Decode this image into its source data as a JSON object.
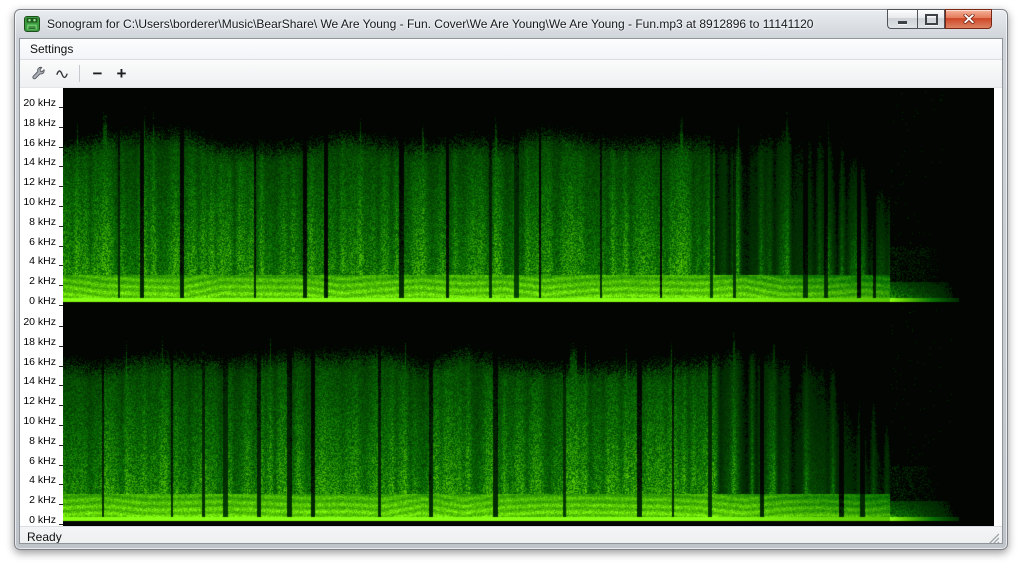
{
  "window": {
    "title": "Sonogram for C:\\Users\\borderer\\Music\\BearShare\\ We Are Young - Fun. Cover\\We Are Young\\We Are Young - Fun.mp3 at 8912896 to 11141120",
    "controls": {
      "minimize": "minimize",
      "maximize": "maximize",
      "close": "close"
    }
  },
  "menu": {
    "items": [
      {
        "label": "Settings"
      }
    ]
  },
  "toolbar": {
    "buttons": [
      {
        "name": "settings-wrench",
        "icon": "wrench-icon"
      },
      {
        "name": "waveform",
        "icon": "sine-wave-icon"
      },
      {
        "name": "zoom-out",
        "label": "−"
      },
      {
        "name": "zoom-in",
        "label": "+"
      }
    ],
    "zoom_out_label": "−",
    "zoom_in_label": "+"
  },
  "statusbar": {
    "text": "Ready"
  },
  "spectrogram": {
    "type": "spectrogram",
    "channels": [
      "left channel",
      "right channel"
    ],
    "freq_labels": [
      "20 kHz",
      "18 kHz",
      "16 kHz",
      "14 kHz",
      "12 kHz",
      "10 kHz",
      "8 kHz",
      "6 kHz",
      "4 kHz",
      "2 kHz",
      "0 kHz"
    ],
    "freq_axis_max_khz": 22,
    "colors": {
      "background": "#030303",
      "dim_green": "#1d4a05",
      "mid_green": "#47a80e",
      "bright_green": "#86ff12"
    },
    "content": {
      "dense_end_frac": 0.7,
      "outro_end_frac": 0.888,
      "tail_end_frac": 0.962,
      "max_content_freq_khz": 15.5
    }
  }
}
